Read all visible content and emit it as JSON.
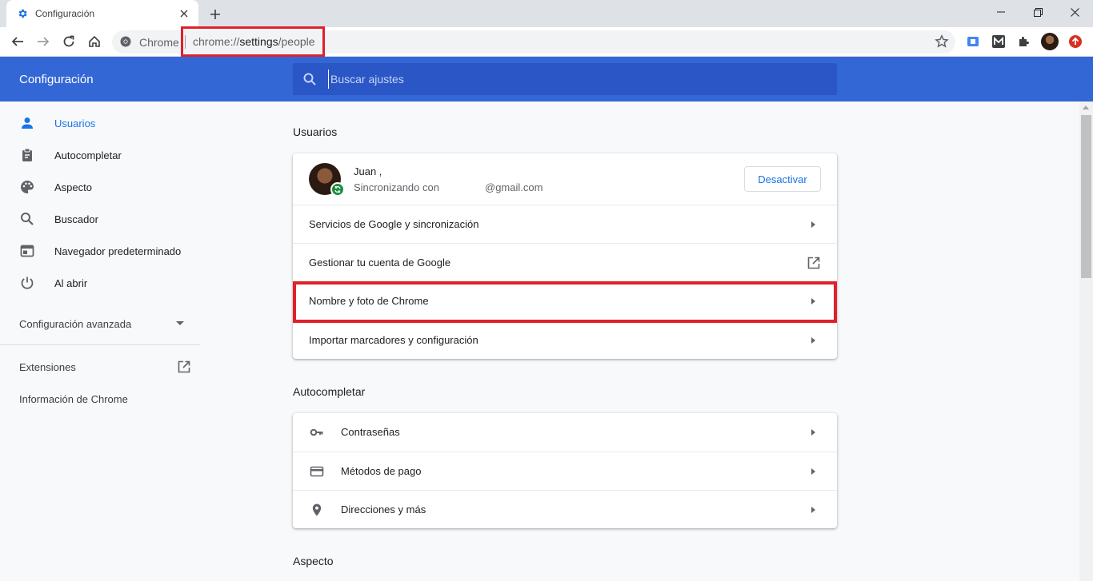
{
  "browser": {
    "tab_title": "Configuración",
    "site_chip": "Chrome",
    "url_scheme": "chrome://",
    "url_host": "settings",
    "url_path": "/people",
    "search_placeholder": "Buscar ajustes"
  },
  "app": {
    "title": "Configuración",
    "accent_color": "#3367d6",
    "link_color": "#1a73e8",
    "highlight_color": "#e0202a"
  },
  "sidebar": {
    "items": [
      {
        "label": "Usuarios",
        "icon": "person-icon",
        "active": true
      },
      {
        "label": "Autocompletar",
        "icon": "clipboard-icon"
      },
      {
        "label": "Aspecto",
        "icon": "palette-icon"
      },
      {
        "label": "Buscador",
        "icon": "search-icon"
      },
      {
        "label": "Navegador predeterminado",
        "icon": "browser-window-icon"
      },
      {
        "label": "Al abrir",
        "icon": "power-icon"
      }
    ],
    "advanced": "Configuración avanzada",
    "extensions": "Extensiones",
    "about": "Información de Chrome"
  },
  "people": {
    "section_title": "Usuarios",
    "profile_name": "Juan ,",
    "sync_text": "Sincronizando con",
    "email": "@gmail.com",
    "turn_off": "Desactivar",
    "rows": [
      "Servicios de Google y sincronización",
      "Gestionar tu cuenta de Google",
      "Nombre y foto de Chrome",
      "Importar marcadores y configuración"
    ]
  },
  "autofill": {
    "section_title": "Autocompletar",
    "rows": [
      {
        "label": "Contraseñas",
        "icon": "key-icon"
      },
      {
        "label": "Métodos de pago",
        "icon": "credit-card-icon"
      },
      {
        "label": "Direcciones y más",
        "icon": "location-pin-icon"
      }
    ]
  },
  "appearance": {
    "section_title": "Aspecto"
  }
}
